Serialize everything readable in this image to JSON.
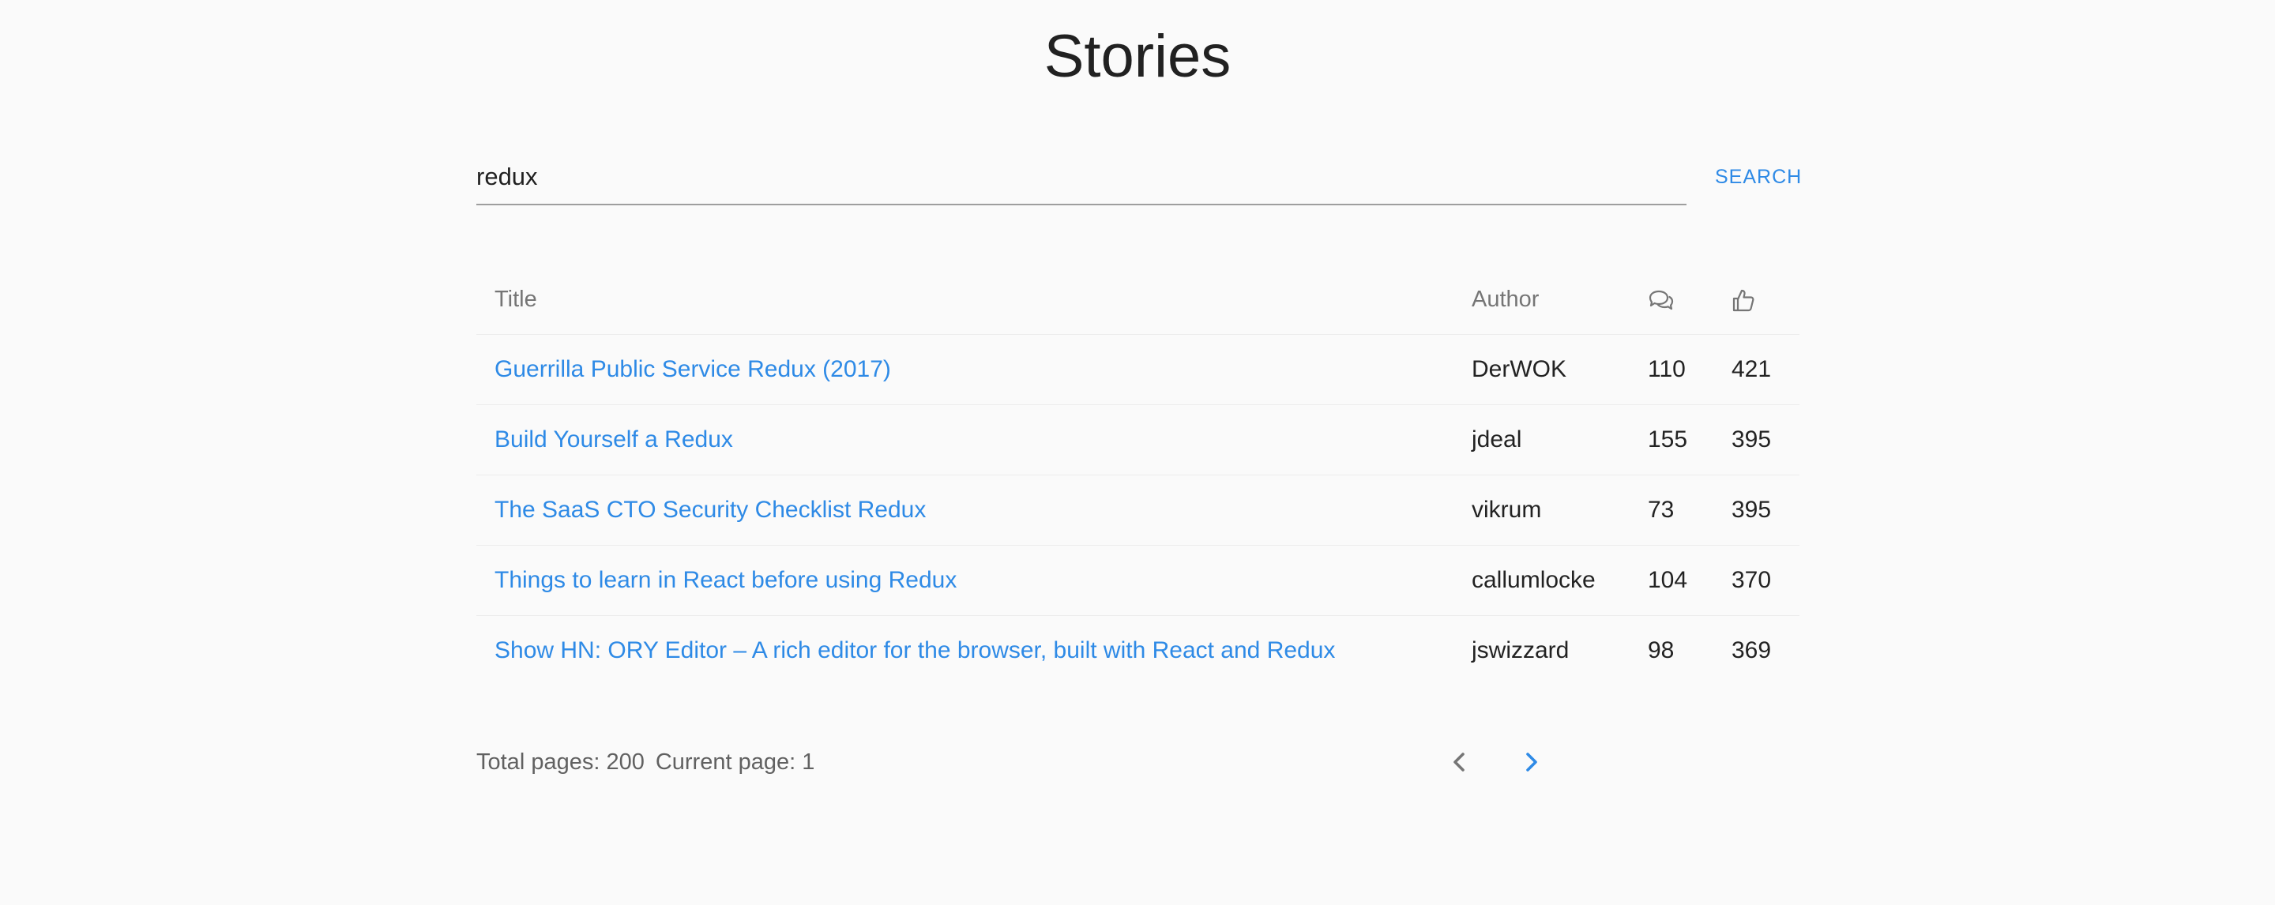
{
  "page": {
    "title": "Stories"
  },
  "search": {
    "value": "redux",
    "button_label": "SEARCH"
  },
  "table": {
    "columns": {
      "title": "Title",
      "author": "Author",
      "comments_icon": "comments-icon",
      "points_icon": "thumbs-up-icon"
    },
    "rows": [
      {
        "title": "Guerrilla Public Service Redux (2017)",
        "author": "DerWOK",
        "comments": "110",
        "points": "421"
      },
      {
        "title": "Build Yourself a Redux",
        "author": "jdeal",
        "comments": "155",
        "points": "395"
      },
      {
        "title": "The SaaS CTO Security Checklist Redux",
        "author": "vikrum",
        "comments": "73",
        "points": "395"
      },
      {
        "title": "Things to learn in React before using Redux",
        "author": "callumlocke",
        "comments": "104",
        "points": "370"
      },
      {
        "title": "Show HN: ORY Editor – A rich editor for the browser, built with React and Redux",
        "author": "jswizzard",
        "comments": "98",
        "points": "369"
      }
    ]
  },
  "pagination": {
    "total_label": "Total pages: 200",
    "current_label": "Current page: 1",
    "prev_icon": "chevron-left-icon",
    "next_icon": "chevron-right-icon"
  },
  "colors": {
    "accent": "#2e8ae6",
    "background": "#fafafa",
    "muted": "#757575"
  }
}
